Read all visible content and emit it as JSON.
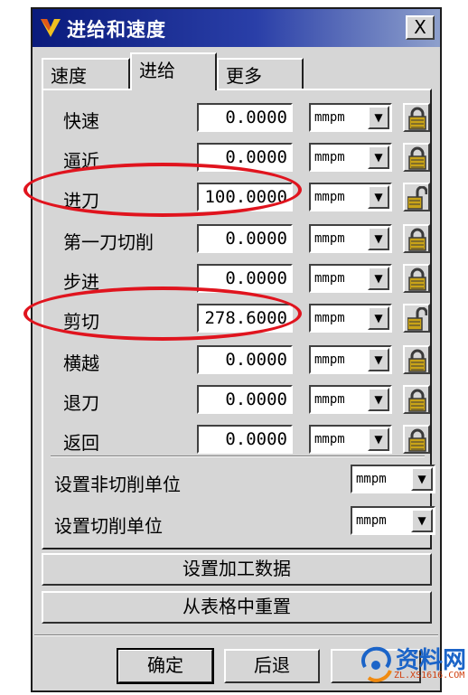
{
  "window": {
    "title": "进给和速度",
    "close_label": "X"
  },
  "tabs": [
    {
      "label": "速度",
      "active": false
    },
    {
      "label": "进给",
      "active": true
    },
    {
      "label": "更多",
      "active": false
    }
  ],
  "feed_rows": [
    {
      "label": "快速",
      "value": "0.0000",
      "unit": "mmpm",
      "lock": "locked"
    },
    {
      "label": "逼近",
      "value": "0.0000",
      "unit": "mmpm",
      "lock": "locked"
    },
    {
      "label": "进刀",
      "value": "100.0000",
      "unit": "mmpm",
      "lock": "unlocked"
    },
    {
      "label": "第一刀切削",
      "value": "0.0000",
      "unit": "mmpm",
      "lock": "locked"
    },
    {
      "label": "步进",
      "value": "0.0000",
      "unit": "mmpm",
      "lock": "locked"
    },
    {
      "label": "剪切",
      "value": "278.6000",
      "unit": "mmpm",
      "lock": "unlocked"
    },
    {
      "label": "横越",
      "value": "0.0000",
      "unit": "mmpm",
      "lock": "locked"
    },
    {
      "label": "退刀",
      "value": "0.0000",
      "unit": "mmpm",
      "lock": "locked"
    },
    {
      "label": "返回",
      "value": "0.0000",
      "unit": "mmpm",
      "lock": "locked"
    }
  ],
  "unit_settings": [
    {
      "label": "设置非切削单位",
      "unit": "mmpm"
    },
    {
      "label": "设置切削单位",
      "unit": "mmpm"
    }
  ],
  "actions": {
    "set_machining_data": "设置加工数据",
    "reset_from_table": "从表格中重置"
  },
  "footer": {
    "ok": "确定",
    "back": "后退",
    "cancel": ""
  },
  "watermark": {
    "text": "资料网",
    "sub": "ZL.XS1616.COM"
  },
  "colors": {
    "titlebar": "#0a1b7c",
    "dialog_bg": "#d6d6d6",
    "highlight": "#e0141e",
    "lock_gold": "#c9a318"
  }
}
